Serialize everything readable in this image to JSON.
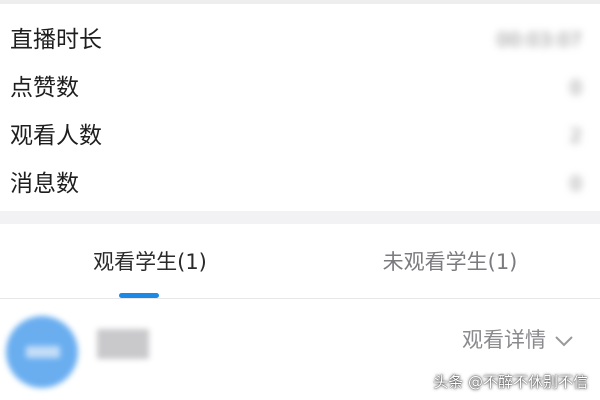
{
  "stats": {
    "rows": [
      {
        "label": "直播时长",
        "value": "00:03:07"
      },
      {
        "label": "点赞数",
        "value": "0"
      },
      {
        "label": "观看人数",
        "value": "2"
      },
      {
        "label": "消息数",
        "value": "0"
      }
    ]
  },
  "tabs": {
    "watched": "观看学生(1)",
    "unwatched": "未观看学生(1)",
    "active": "watched"
  },
  "student_list": {
    "items": [
      {
        "name": "",
        "detail_label": "观看详情"
      }
    ]
  },
  "colors": {
    "accent": "#1e88e5",
    "avatar": "#6aaef0"
  },
  "watermark": "头条 @不醉不休别不信"
}
